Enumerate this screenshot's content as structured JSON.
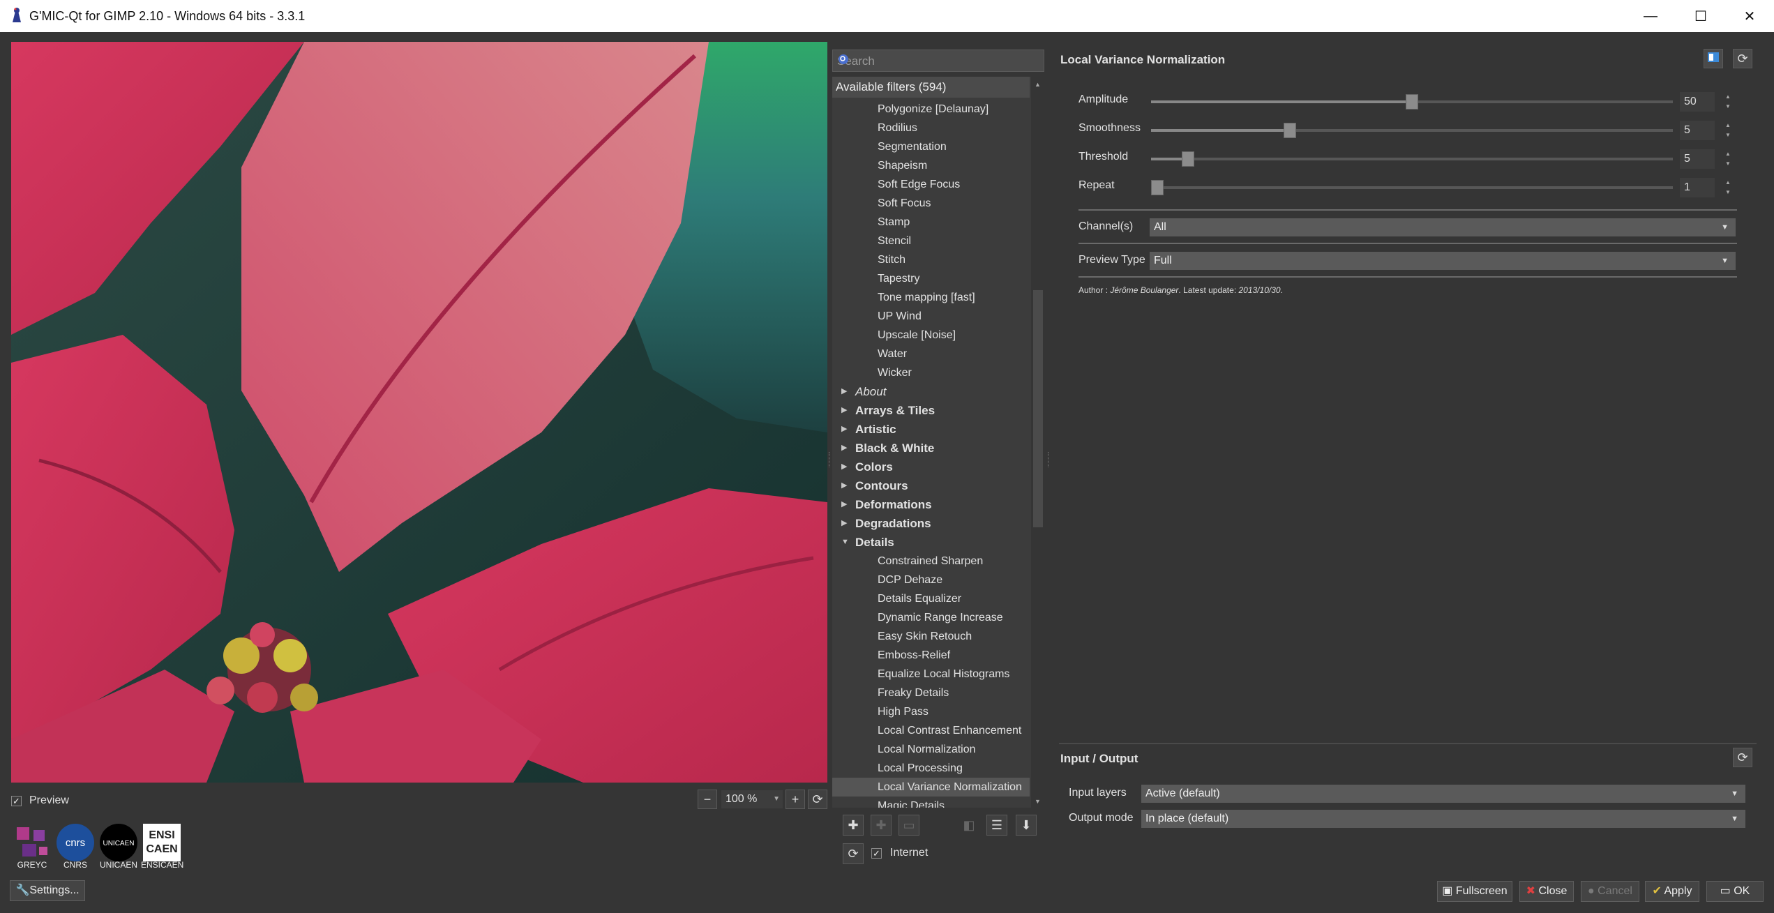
{
  "window": {
    "title": "G'MIC-Qt for GIMP 2.10 - Windows 64 bits - 3.3.1",
    "controls": {
      "minimize": "—",
      "maximize": "☐",
      "close": "✕"
    }
  },
  "preview": {
    "checkbox_label": "Preview",
    "checked": true,
    "zoom": "100 %"
  },
  "logos": [
    "GREYC",
    "CNRS",
    "UNICAEN",
    "ENSICAEN"
  ],
  "settings_button": "Settings...",
  "search": {
    "placeholder": "Search"
  },
  "filters": {
    "header": "Available filters (594)",
    "items": [
      {
        "label": "Polygonize [Delaunay]",
        "kind": "item"
      },
      {
        "label": "Rodilius",
        "kind": "item"
      },
      {
        "label": "Segmentation",
        "kind": "item"
      },
      {
        "label": "Shapeism",
        "kind": "item"
      },
      {
        "label": "Soft Edge Focus",
        "kind": "item"
      },
      {
        "label": "Soft Focus",
        "kind": "item"
      },
      {
        "label": "Stamp",
        "kind": "item"
      },
      {
        "label": "Stencil",
        "kind": "item"
      },
      {
        "label": "Stitch",
        "kind": "item"
      },
      {
        "label": "Tapestry",
        "kind": "item"
      },
      {
        "label": "Tone mapping [fast]",
        "kind": "item"
      },
      {
        "label": "UP Wind",
        "kind": "item"
      },
      {
        "label": "Upscale [Noise]",
        "kind": "item"
      },
      {
        "label": "Water",
        "kind": "item"
      },
      {
        "label": "Wicker",
        "kind": "item"
      },
      {
        "label": "About",
        "kind": "cat-italic"
      },
      {
        "label": "Arrays & Tiles",
        "kind": "cat"
      },
      {
        "label": "Artistic",
        "kind": "cat"
      },
      {
        "label": "Black & White",
        "kind": "cat"
      },
      {
        "label": "Colors",
        "kind": "cat"
      },
      {
        "label": "Contours",
        "kind": "cat"
      },
      {
        "label": "Deformations",
        "kind": "cat"
      },
      {
        "label": "Degradations",
        "kind": "cat"
      },
      {
        "label": "Details",
        "kind": "cat-open"
      },
      {
        "label": "Constrained Sharpen",
        "kind": "item"
      },
      {
        "label": "DCP Dehaze",
        "kind": "item"
      },
      {
        "label": "Details Equalizer",
        "kind": "item"
      },
      {
        "label": "Dynamic Range Increase",
        "kind": "item"
      },
      {
        "label": "Easy Skin Retouch",
        "kind": "item"
      },
      {
        "label": "Emboss-Relief",
        "kind": "item"
      },
      {
        "label": "Equalize Local Histograms",
        "kind": "item"
      },
      {
        "label": "Freaky Details",
        "kind": "item"
      },
      {
        "label": "High Pass",
        "kind": "item"
      },
      {
        "label": "Local Contrast Enhancement",
        "kind": "item"
      },
      {
        "label": "Local Normalization",
        "kind": "item"
      },
      {
        "label": "Local Processing",
        "kind": "item"
      },
      {
        "label": "Local Variance Normalization",
        "kind": "item-selected"
      },
      {
        "label": "Magic Details",
        "kind": "item"
      }
    ],
    "internet_label": "Internet",
    "internet_checked": true
  },
  "filter": {
    "title": "Local Variance Normalization",
    "params": [
      {
        "label": "Amplitude",
        "value": "50",
        "fraction": 0.5
      },
      {
        "label": "Smoothness",
        "value": "5",
        "fraction": 0.26
      },
      {
        "label": "Threshold",
        "value": "5",
        "fraction": 0.06
      },
      {
        "label": "Repeat",
        "value": "1",
        "fraction": 0.0
      }
    ],
    "channels": {
      "label": "Channel(s)",
      "value": "All"
    },
    "preview_type": {
      "label": "Preview Type",
      "value": "Full"
    },
    "author": {
      "prefix": "Author : ",
      "name": "Jérôme Boulanger",
      "mid": ". Latest update: ",
      "date": "2013/10/30",
      "suffix": "."
    }
  },
  "io": {
    "title": "Input / Output",
    "input_layers": {
      "label": "Input layers",
      "value": "Active (default)"
    },
    "output_mode": {
      "label": "Output mode",
      "value": "In place (default)"
    }
  },
  "buttons": {
    "fullscreen": "Fullscreen",
    "close": "Close",
    "cancel": "Cancel",
    "apply": "Apply",
    "ok": "OK"
  }
}
